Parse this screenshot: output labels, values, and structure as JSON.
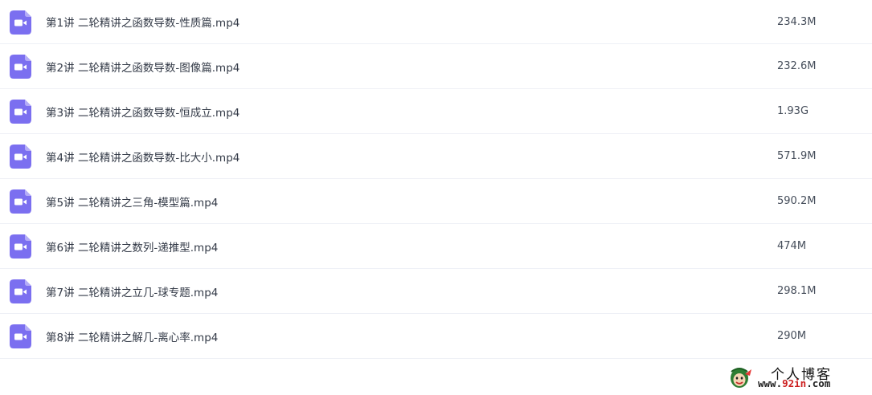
{
  "files": [
    {
      "name": "第1讲 二轮精讲之函数导数-性质篇.mp4",
      "size": "234.3M",
      "icon": "video-file-icon"
    },
    {
      "name": "第2讲 二轮精讲之函数导数-图像篇.mp4",
      "size": "232.6M",
      "icon": "video-file-icon"
    },
    {
      "name": "第3讲 二轮精讲之函数导数-恒成立.mp4",
      "size": "1.93G",
      "icon": "video-file-icon"
    },
    {
      "name": "第4讲 二轮精讲之函数导数-比大小.mp4",
      "size": "571.9M",
      "icon": "video-file-icon"
    },
    {
      "name": "第5讲 二轮精讲之三角-模型篇.mp4",
      "size": "590.2M",
      "icon": "video-file-icon"
    },
    {
      "name": "第6讲 二轮精讲之数列-递推型.mp4",
      "size": "474M",
      "icon": "video-file-icon"
    },
    {
      "name": "第7讲 二轮精讲之立几-球专题.mp4",
      "size": "298.1M",
      "icon": "video-file-icon"
    },
    {
      "name": "第8讲 二轮精讲之解几-离心率.mp4",
      "size": "290M",
      "icon": "video-file-icon"
    }
  ],
  "watermark": {
    "title": "个人博客",
    "url_prefix": "www.",
    "url_accent": "92in",
    "url_suffix": ".com"
  },
  "colors": {
    "icon_bg": "#7b6ff0",
    "icon_fold": "#b4acf7",
    "row_border": "#eef0f6",
    "name_text": "#333a47",
    "size_text": "#454d5a",
    "watermark_accent": "#cc1f1f"
  }
}
